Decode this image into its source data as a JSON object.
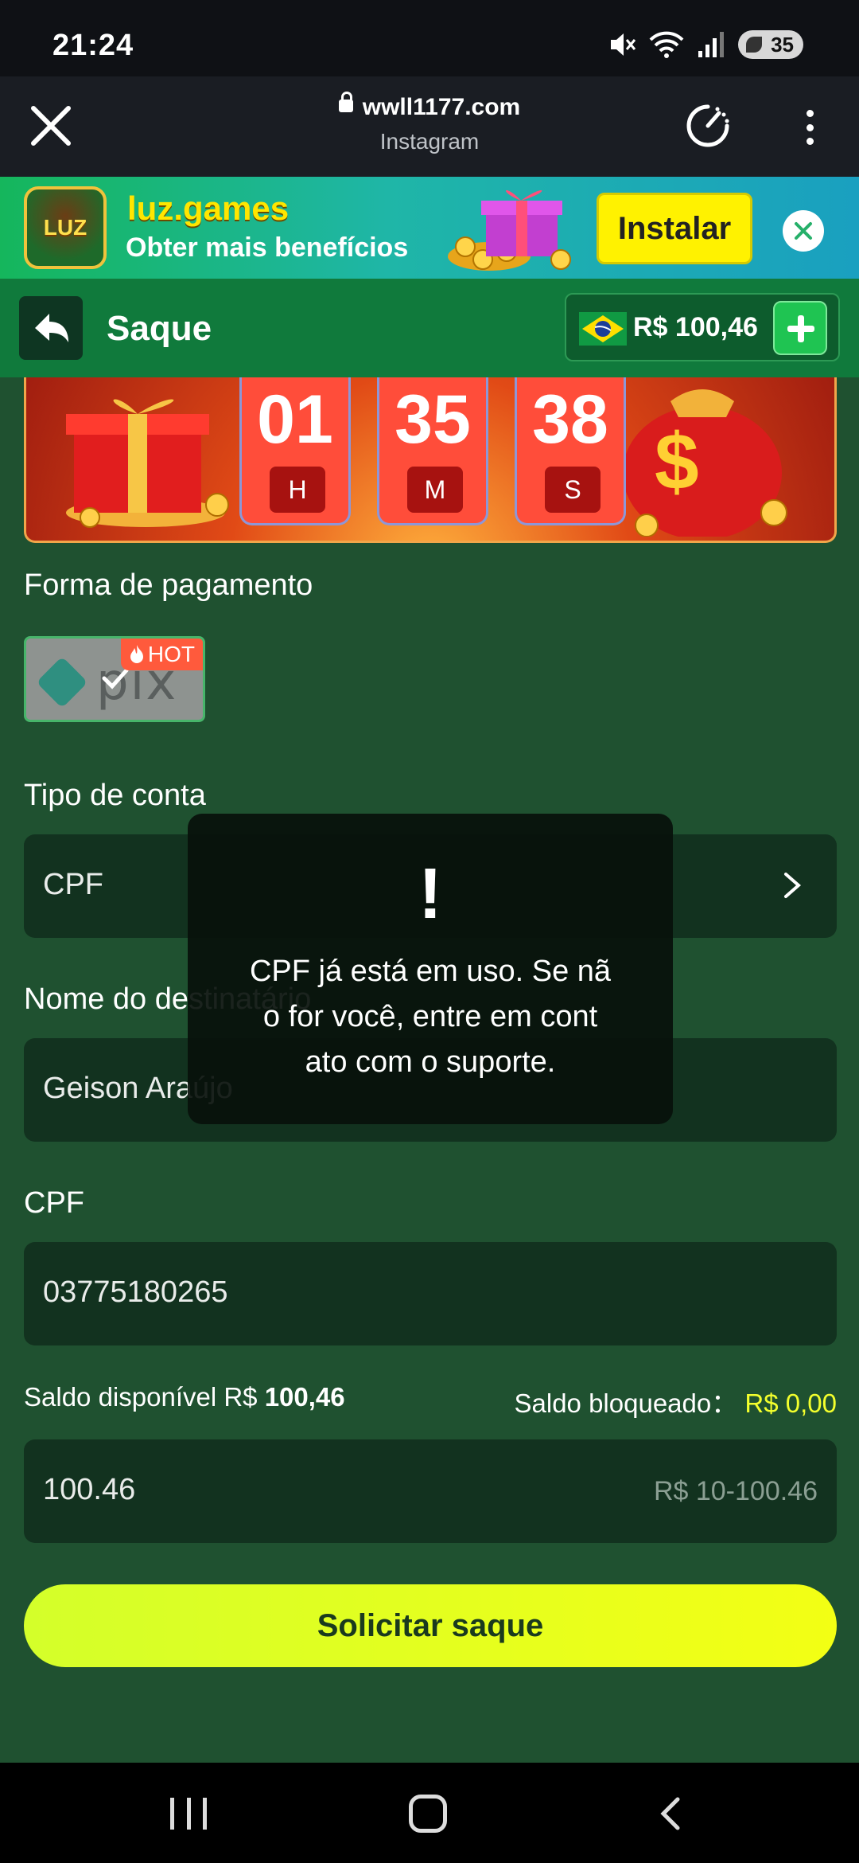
{
  "status_bar": {
    "time": "21:24",
    "icons": [
      "mute-icon",
      "wifi-icon",
      "signal-icon"
    ],
    "battery": "35"
  },
  "browser": {
    "url": "wwll1177.com",
    "source": "Instagram"
  },
  "install_banner": {
    "app_logo_text": "LUZ",
    "title": "luz.games",
    "subtitle": "Obter mais benefícios",
    "install_label": "Instalar"
  },
  "header": {
    "title": "Saque",
    "balance": "R$ 100,46"
  },
  "timer": {
    "hours": "01",
    "hours_unit": "H",
    "minutes": "35",
    "minutes_unit": "M",
    "seconds": "38",
    "seconds_unit": "S"
  },
  "payment": {
    "label": "Forma de pagamento",
    "method": "pix",
    "badge": "HOT"
  },
  "account_type": {
    "label": "Tipo de conta",
    "value": "CPF"
  },
  "recipient": {
    "label": "Nome do destinatário",
    "value": "Geison Araújo"
  },
  "cpf": {
    "label": "CPF",
    "value": "03775180265"
  },
  "saldo": {
    "available_label": "Saldo disponível R$",
    "available_value": "100,46",
    "blocked_label": "Saldo bloqueado：",
    "blocked_value": "R$ 0,00"
  },
  "amount": {
    "value": "100.46",
    "range": "R$ 10-100.46"
  },
  "submit_label": "Solicitar saque",
  "toast": {
    "icon": "!",
    "line1": "CPF já está em uso. Se nã",
    "line2": "o for você, entre em cont",
    "line3": "ato com o suporte."
  },
  "colors": {
    "page_bg": "#1f5130",
    "header_bg": "#107a3c",
    "field_bg": "#12321f",
    "submit": "#e8ff1a",
    "blocked_value": "#f3ff2d"
  }
}
